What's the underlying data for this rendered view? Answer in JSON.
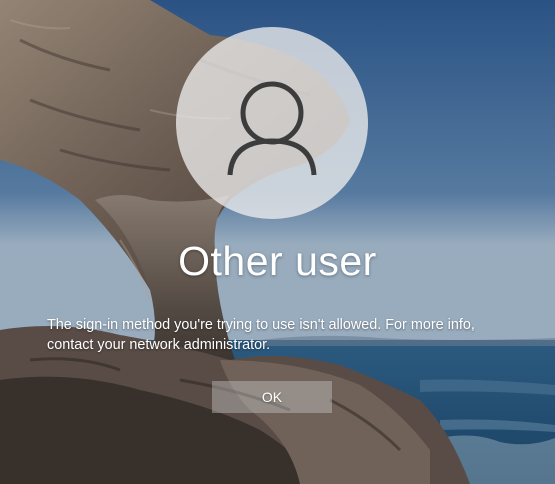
{
  "lock_screen": {
    "user_name": "Other user",
    "message": "The sign-in method you're trying to use isn't allowed. For more info, contact your network administrator.",
    "ok_label": "OK",
    "avatar_icon": "user-icon"
  },
  "colors": {
    "sky": "#2f5a89",
    "sea": "#1e4f78",
    "rock": "#7a6a5c",
    "avatar_circle": "#ececec",
    "avatar_glyph": "#3c3c3c",
    "text": "#ffffff"
  }
}
